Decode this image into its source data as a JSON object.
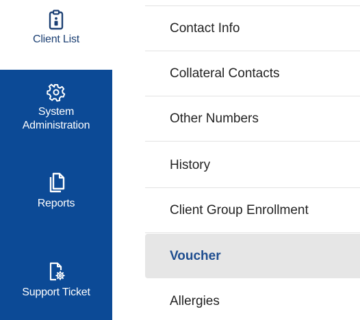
{
  "sidebar": {
    "items": [
      {
        "label": "Client List",
        "icon": "clipboard-icon"
      },
      {
        "label": "System\nAdministration",
        "label_line1": "System",
        "label_line2": "Administration",
        "icon": "gear-icon"
      },
      {
        "label": "Reports",
        "icon": "documents-icon"
      },
      {
        "label": "Support Ticket",
        "icon": "document-gear-icon"
      }
    ],
    "colors": {
      "rail_background": "#0c4a96",
      "inactive_label": "#1b3f73",
      "active_text": "#ffffff"
    }
  },
  "menu": {
    "items": [
      {
        "label": "Contact Info",
        "active": false
      },
      {
        "label": "Collateral Contacts",
        "active": false
      },
      {
        "label": "Other Numbers",
        "active": false
      },
      {
        "label": "History",
        "active": false
      },
      {
        "label": "Client Group Enrollment",
        "active": false
      },
      {
        "label": "Voucher",
        "active": true
      },
      {
        "label": "Allergies",
        "active": false
      }
    ],
    "colors": {
      "active_background": "#e6e6e6",
      "active_text": "#1e4d8f",
      "text": "#222222",
      "divider": "#e2e2e2"
    }
  }
}
